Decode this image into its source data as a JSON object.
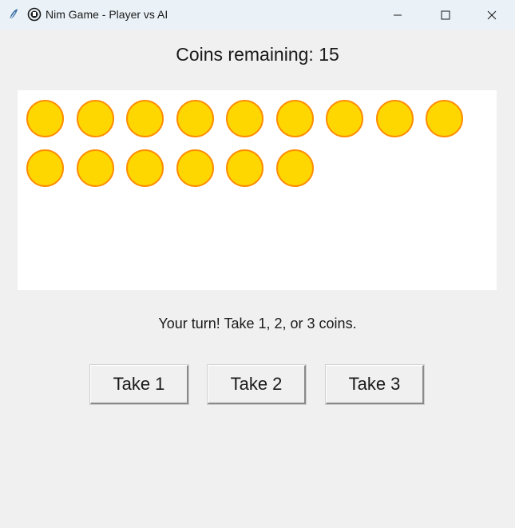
{
  "window": {
    "title": "Nim Game - Player vs AI",
    "icons": [
      "feather-icon",
      "app-glyph-icon",
      "minimize-icon",
      "maximize-icon",
      "close-icon"
    ]
  },
  "game": {
    "coins_label": "Coins remaining: 15",
    "coins_remaining": 15,
    "status": "Your turn! Take 1, 2, or 3 coins."
  },
  "buttons": {
    "take1": "Take 1",
    "take2": "Take 2",
    "take3": "Take 3"
  },
  "colors": {
    "coin_fill": "#ffd700",
    "coin_outline": "#ff8c00",
    "canvas": "#ffffff",
    "window_bg": "#f0f0f0"
  }
}
